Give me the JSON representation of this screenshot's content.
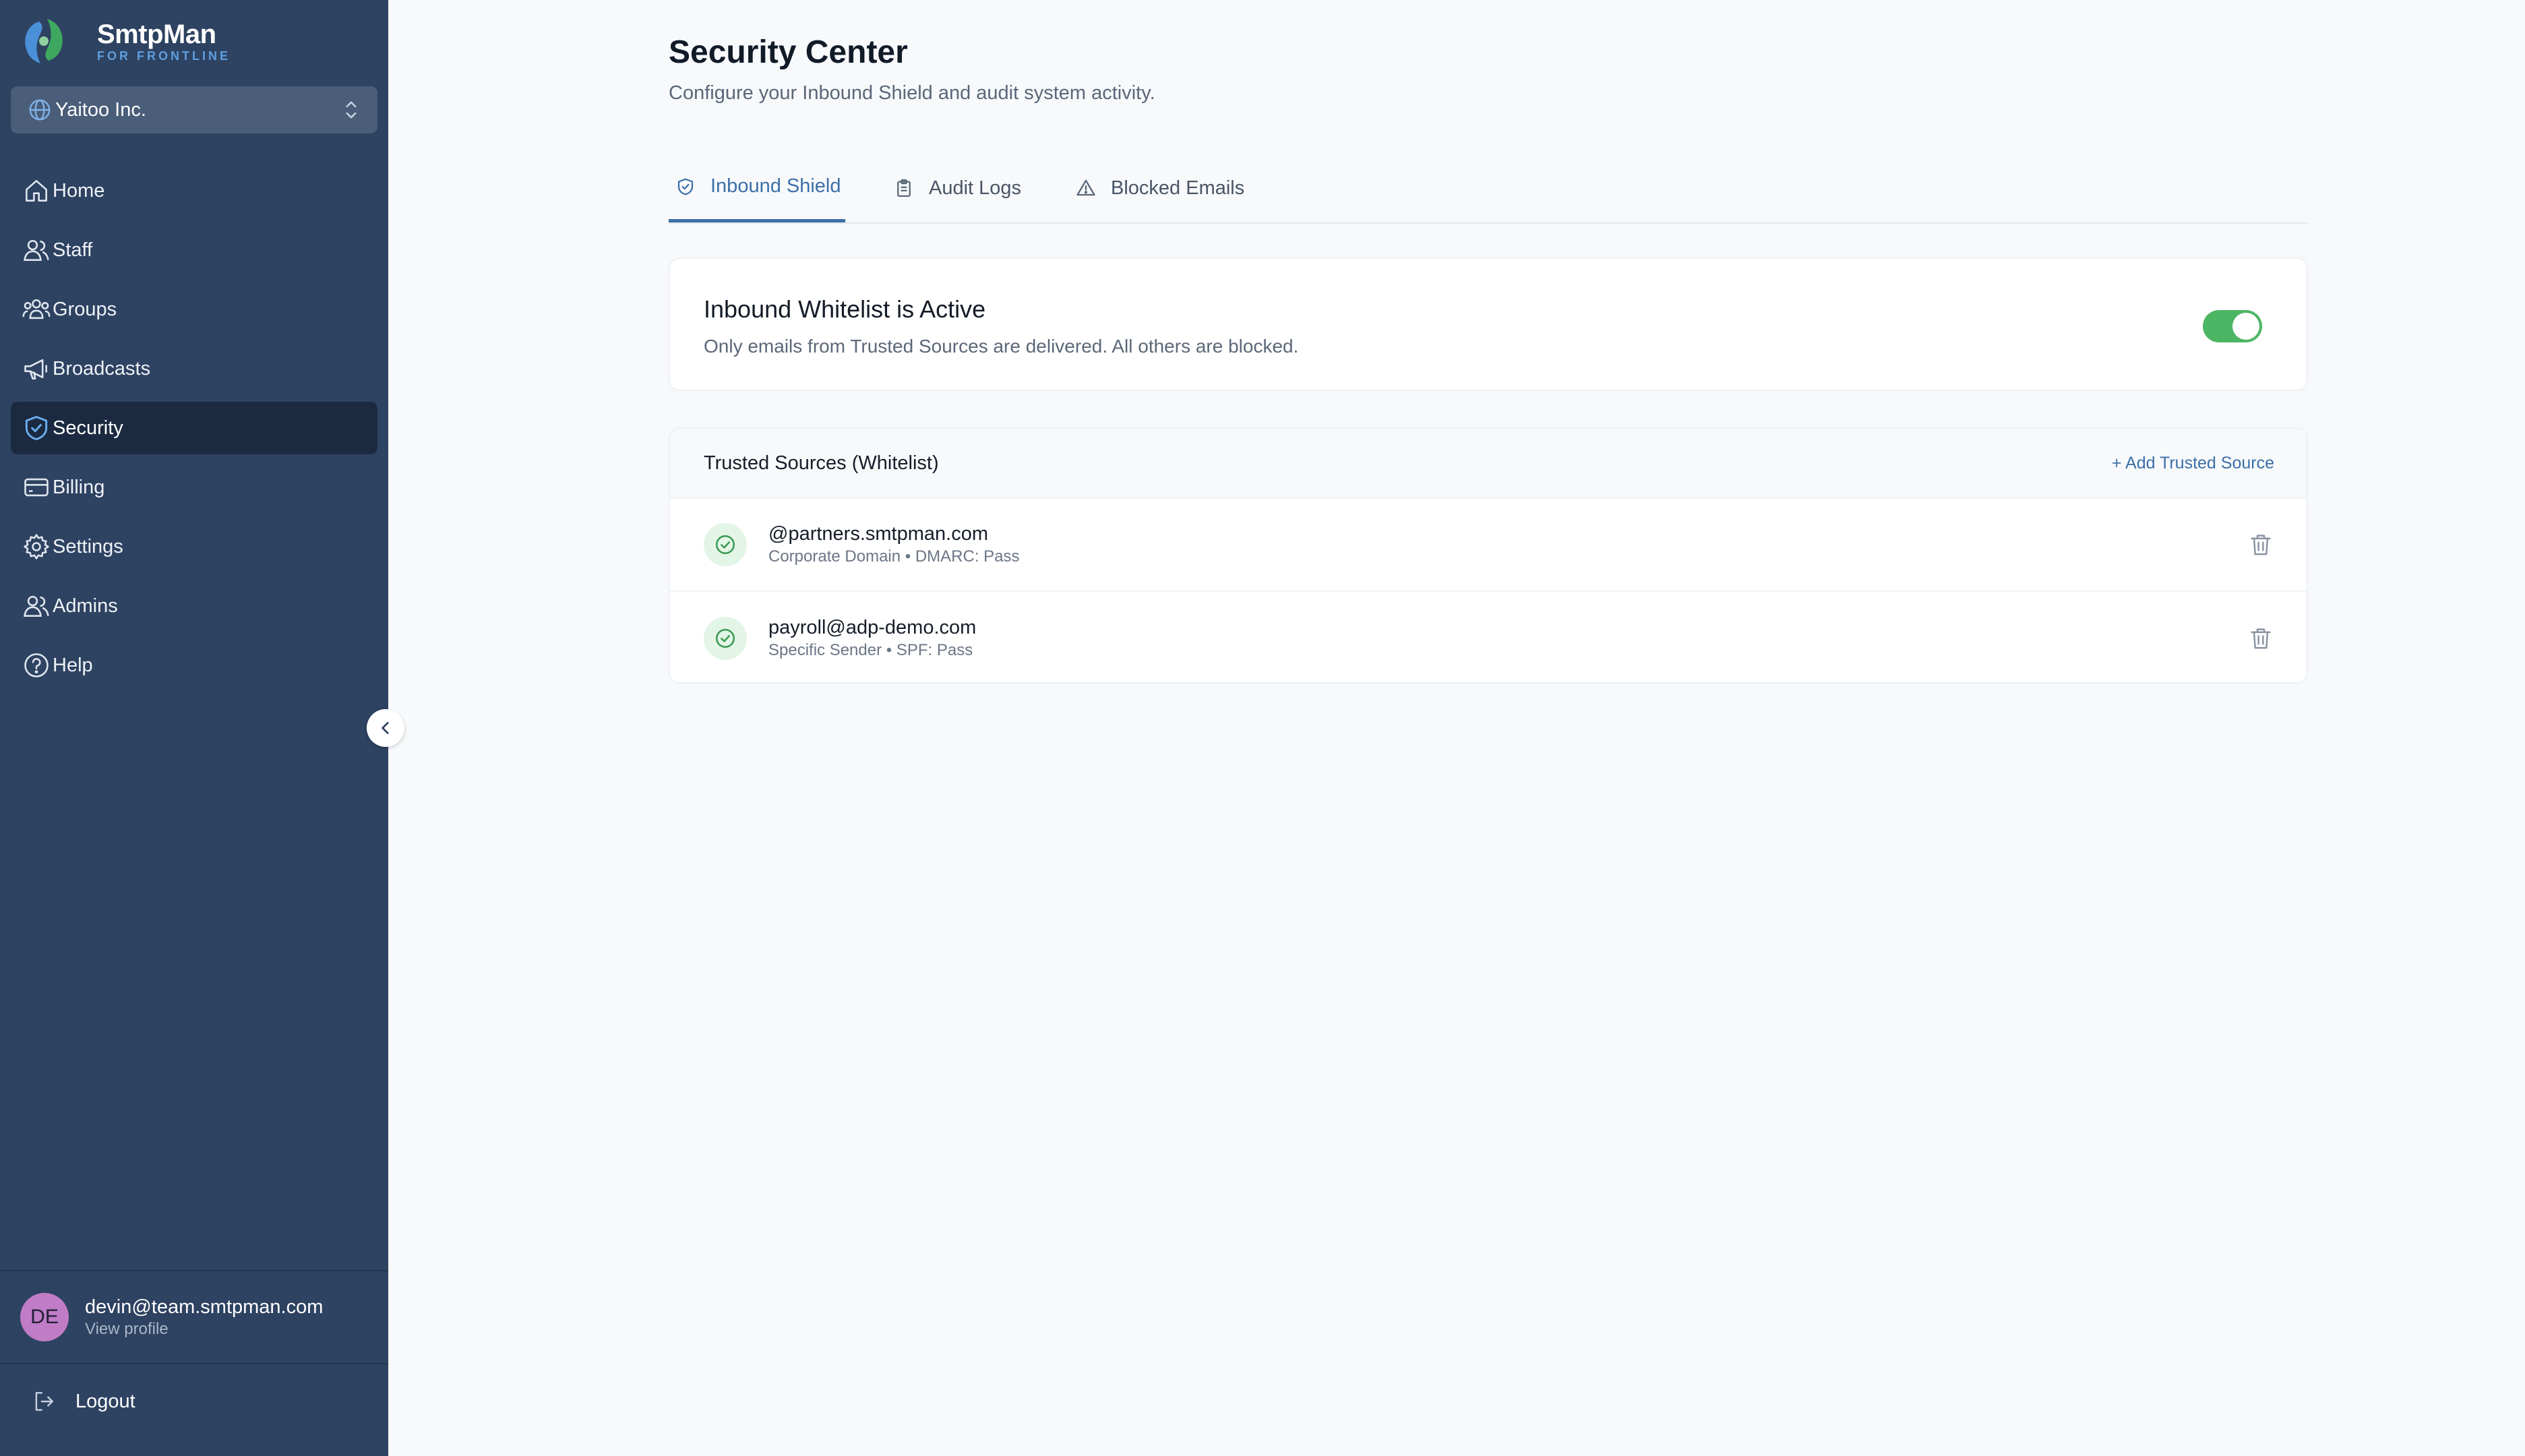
{
  "brand": {
    "name": "SmtpMan",
    "tagline": "FOR FRONTLINE"
  },
  "org_selector": {
    "value": "Yaitoo Inc.",
    "icon": "globe-icon"
  },
  "sidebar": {
    "items": [
      {
        "label": "Home",
        "icon": "home-icon",
        "active": false
      },
      {
        "label": "Staff",
        "icon": "users-icon",
        "active": false
      },
      {
        "label": "Groups",
        "icon": "groups-icon",
        "active": false
      },
      {
        "label": "Broadcasts",
        "icon": "megaphone-icon",
        "active": false
      },
      {
        "label": "Security",
        "icon": "shield-check-icon",
        "active": true
      },
      {
        "label": "Billing",
        "icon": "credit-card-icon",
        "active": false
      },
      {
        "label": "Settings",
        "icon": "gear-icon",
        "active": false
      },
      {
        "label": "Admins",
        "icon": "users-icon",
        "active": false
      },
      {
        "label": "Help",
        "icon": "help-circle-icon",
        "active": false
      }
    ]
  },
  "profile": {
    "initials": "DE",
    "email": "devin@team.smtpman.com",
    "link": "View profile"
  },
  "logout": {
    "label": "Logout"
  },
  "page": {
    "title": "Security Center",
    "subtitle": "Configure your Inbound Shield and audit system activity."
  },
  "tabs": [
    {
      "label": "Inbound Shield",
      "icon": "shield-check-icon",
      "active": true
    },
    {
      "label": "Audit Logs",
      "icon": "clipboard-icon",
      "active": false
    },
    {
      "label": "Blocked Emails",
      "icon": "warning-icon",
      "active": false
    }
  ],
  "whitelist_status": {
    "title": "Inbound Whitelist is Active",
    "description": "Only emails from Trusted Sources are delivered. All others are blocked.",
    "enabled": true
  },
  "trusted_sources": {
    "title": "Trusted Sources (Whitelist)",
    "add_label": "+ Add Trusted Source",
    "rows": [
      {
        "name": "@partners.smtpman.com",
        "meta": "Corporate Domain • DMARC: Pass"
      },
      {
        "name": "payroll@adp-demo.com",
        "meta": "Specific Sender • SPF: Pass"
      }
    ]
  },
  "colors": {
    "sidebar_bg": "#2e4261",
    "sidebar_active": "#1b2a40",
    "accent": "#3c6fa8",
    "toggle_on": "#4cb563",
    "avatar": "#c07cc6"
  }
}
